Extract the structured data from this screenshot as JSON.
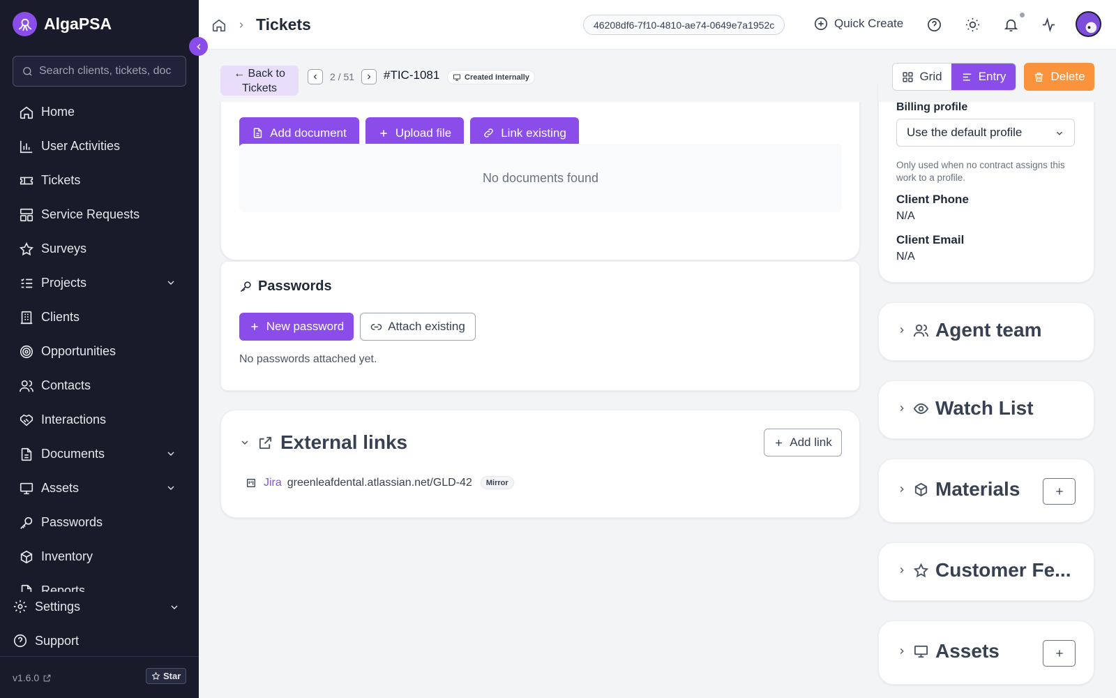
{
  "app": {
    "name": "AlgaPSA"
  },
  "sidebar": {
    "search_placeholder": "Search clients, tickets, doc",
    "items": [
      {
        "label": "Home",
        "icon": "home-icon"
      },
      {
        "label": "User Activities",
        "icon": "chart-icon"
      },
      {
        "label": "Tickets",
        "icon": "ticket-icon"
      },
      {
        "label": "Service Requests",
        "icon": "layout-icon"
      },
      {
        "label": "Surveys",
        "icon": "star-icon"
      },
      {
        "label": "Projects",
        "icon": "list-icon",
        "expandable": true
      },
      {
        "label": "Clients",
        "icon": "building-icon"
      },
      {
        "label": "Opportunities",
        "icon": "target-icon"
      },
      {
        "label": "Contacts",
        "icon": "users-icon"
      },
      {
        "label": "Interactions",
        "icon": "handshake-icon"
      },
      {
        "label": "Documents",
        "icon": "document-icon",
        "expandable": true
      },
      {
        "label": "Assets",
        "icon": "monitor-icon",
        "expandable": true
      },
      {
        "label": "Passwords",
        "icon": "key-icon"
      },
      {
        "label": "Inventory",
        "icon": "box-icon"
      },
      {
        "label": "Reports",
        "icon": "report-icon"
      }
    ],
    "settings_label": "Settings",
    "support_label": "Support",
    "version": "v1.6.0",
    "star_label": "Star"
  },
  "topbar": {
    "breadcrumb_title": "Tickets",
    "uuid": "46208df6-7f10-4810-ae74-0649e7a1952c",
    "quick_create_label": "Quick Create"
  },
  "ticket": {
    "back_label_line1": "← Back to",
    "back_label_line2": "Tickets",
    "position": "2 / 51",
    "id": "#TIC-1081",
    "created_badge": "Created Internally",
    "view_grid_label": "Grid",
    "view_entry_label": "Entry",
    "delete_label": "Delete"
  },
  "documents": {
    "add_document_label": "Add document",
    "upload_file_label": "Upload file",
    "link_existing_label": "Link existing",
    "empty_text": "No documents found"
  },
  "passwords": {
    "title": "Passwords",
    "new_password_label": "New password",
    "attach_existing_label": "Attach existing",
    "empty_text": "No passwords attached yet."
  },
  "external_links": {
    "title": "External links",
    "add_link_label": "Add link",
    "links": [
      {
        "source": "Jira",
        "url": "greenleafdental.atlassian.net/GLD-42",
        "badge": "Mirror"
      }
    ]
  },
  "details": {
    "billing_profile_label": "Billing profile",
    "billing_profile_value": "Use the default profile",
    "billing_hint": "Only used when no contract assigns this work to a profile.",
    "client_phone_label": "Client Phone",
    "client_phone_value": "N/A",
    "client_email_label": "Client Email",
    "client_email_value": "N/A"
  },
  "side_cards": [
    {
      "title": "Agent team",
      "icon": "users-icon"
    },
    {
      "title": "Watch List",
      "icon": "eye-icon"
    },
    {
      "title": "Materials",
      "icon": "box-icon"
    },
    {
      "title": "Customer Fe...",
      "icon": "star-icon"
    },
    {
      "title": "Assets",
      "icon": "monitor-icon"
    }
  ],
  "colors": {
    "accent": "#8a4dea",
    "sidebar_bg": "#191b2a",
    "delete": "#fb923c"
  }
}
